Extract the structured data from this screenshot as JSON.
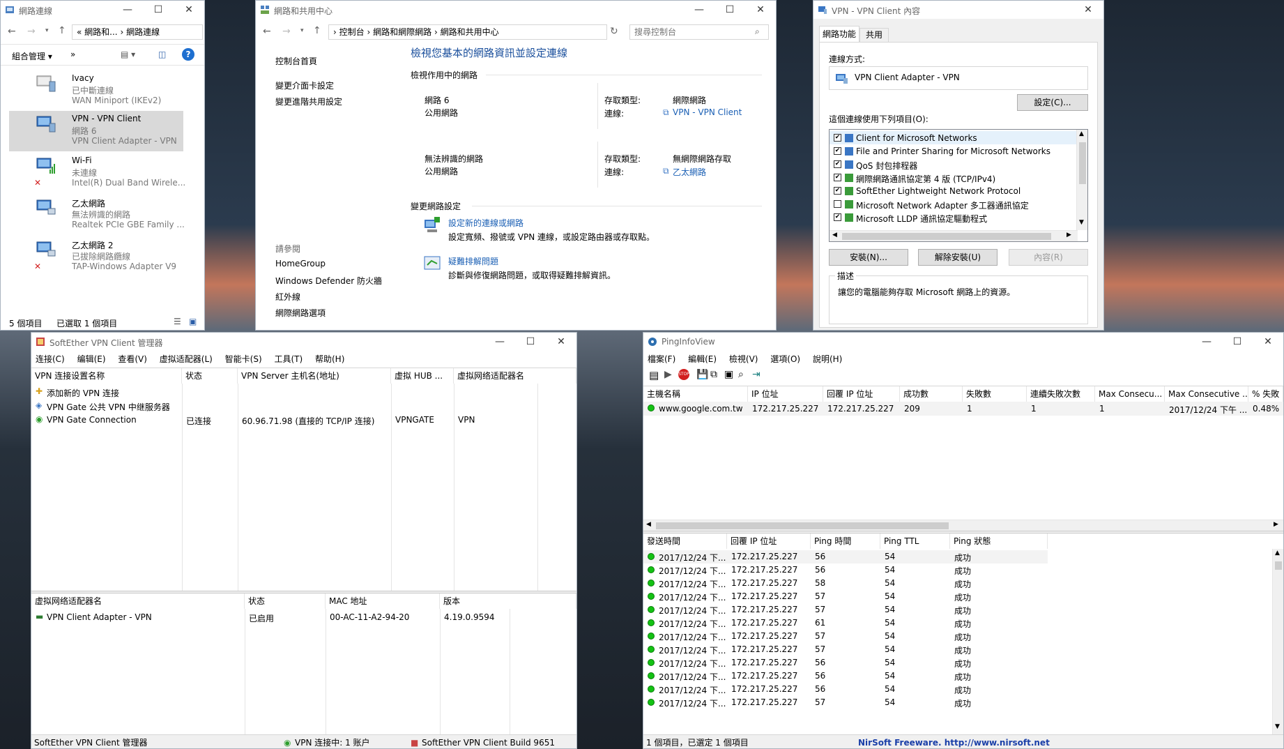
{
  "explorer": {
    "title": "網路連線",
    "address": [
      "«",
      "網路和...",
      "›",
      "網路連線"
    ],
    "toolbar_organize": "組合管理 ▾",
    "toolbar_more": "»",
    "items": [
      {
        "name": "Ivacy",
        "status": "已中斷連線",
        "device": "WAN Miniport (IKEv2)"
      },
      {
        "name": "VPN - VPN Client",
        "status": "網路  6",
        "device": "VPN Client Adapter - VPN"
      },
      {
        "name": "Wi-Fi",
        "status": "未連線",
        "device": "Intel(R) Dual Band Wirele..."
      },
      {
        "name": "乙太網路",
        "status": "無法辨識的網路",
        "device": "Realtek PCIe GBE Family ..."
      },
      {
        "name": "乙太網路 2",
        "status": "已拔除網路纜線",
        "device": "TAP-Windows Adapter V9"
      }
    ],
    "status_count": "5 個項目",
    "status_selected": "已選取 1 個項目"
  },
  "nsc": {
    "title": "網路和共用中心",
    "address": [
      "›",
      "控制台",
      "›",
      "網路和網際網路",
      "›",
      "網路和共用中心"
    ],
    "search_placeholder": "搜尋控制台",
    "side_links": [
      "控制台首頁",
      "變更介面卡設定",
      "變更進階共用設定"
    ],
    "see_also_label": "請參閱",
    "see_also": [
      "HomeGroup",
      "Windows Defender 防火牆",
      "紅外線",
      "網際網路選項"
    ],
    "heading": "檢視您基本的網路資訊並設定連線",
    "active_label": "檢視作用中的網路",
    "networks": [
      {
        "name": "網路  6",
        "type": "公用網路",
        "access_label": "存取類型:",
        "access": "網際網路",
        "conn_label": "連線:",
        "conn": "VPN - VPN Client"
      },
      {
        "name": "無法辨識的網路",
        "type": "公用網路",
        "access_label": "存取類型:",
        "access": "無網際網路存取",
        "conn_label": "連線:",
        "conn": "乙太網路"
      }
    ],
    "change_label": "變更網路設定",
    "tasks": [
      {
        "title": "設定新的連線或網路",
        "desc": "設定寬頻、撥號或 VPN 連線，或設定路由器或存取點。"
      },
      {
        "title": "疑難排解問題",
        "desc": "診斷與修復網路問題，或取得疑難排解資訊。"
      }
    ]
  },
  "props": {
    "title": "VPN - VPN Client 內容",
    "tabs": [
      "網路功能",
      "共用"
    ],
    "connect_using": "連線方式:",
    "adapter": "VPN Client Adapter - VPN",
    "configure": "設定(C)...",
    "items_label": "這個連線使用下列項目(O):",
    "items": [
      {
        "checked": true,
        "label": "Client for Microsoft Networks"
      },
      {
        "checked": true,
        "label": "File and Printer Sharing for Microsoft Networks"
      },
      {
        "checked": true,
        "label": "QoS 封包排程器"
      },
      {
        "checked": true,
        "label": "網際網路通訊協定第 4 版 (TCP/IPv4)"
      },
      {
        "checked": true,
        "label": "SoftEther Lightweight Network Protocol"
      },
      {
        "checked": false,
        "label": "Microsoft Network Adapter 多工器通訊協定"
      },
      {
        "checked": true,
        "label": "Microsoft LLDP 通訊協定驅動程式"
      }
    ],
    "install": "安裝(N)...",
    "uninstall": "解除安裝(U)",
    "properties": "內容(R)",
    "desc_label": "描述",
    "desc": "讓您的電腦能夠存取 Microsoft 網路上的資源。"
  },
  "softether": {
    "title": "SoftEther VPN Client 管理器",
    "menu": [
      "连接(C)",
      "编辑(E)",
      "查看(V)",
      "虚拟适配器(L)",
      "智能卡(S)",
      "工具(T)",
      "帮助(H)"
    ],
    "columns": [
      "VPN 连接设置名称",
      "状态",
      "VPN Server 主机名(地址)",
      "虚拟 HUB ...",
      "虚拟网络适配器名"
    ],
    "rows": [
      {
        "name": "添加新的 VPN 连接",
        "status": "",
        "server": "",
        "hub": "",
        "adapter": ""
      },
      {
        "name": "VPN Gate 公共 VPN 中继服务器",
        "status": "",
        "server": "",
        "hub": "",
        "adapter": ""
      },
      {
        "name": "VPN Gate Connection",
        "status": "已连接",
        "server": "60.96.71.98 (直接的 TCP/IP 连接)",
        "hub": "VPNGATE",
        "adapter": "VPN"
      }
    ],
    "adapter_columns": [
      "虚拟网络适配器名",
      "状态",
      "MAC 地址",
      "版本"
    ],
    "adapter_rows": [
      {
        "name": "VPN Client Adapter - VPN",
        "status": "已启用",
        "mac": "00-AC-11-A2-94-20",
        "version": "4.19.0.9594"
      }
    ],
    "status_left": "SoftEther VPN Client 管理器",
    "status_mid": "VPN 连接中: 1 账户",
    "status_right": "SoftEther VPN Client Build 9651"
  },
  "ping": {
    "title": "PingInfoView",
    "menu": [
      "檔案(F)",
      "編輯(E)",
      "檢視(V)",
      "選項(O)",
      "說明(H)"
    ],
    "columns": [
      "主機名稱",
      "IP 位址",
      "回覆 IP 位址",
      "成功數",
      "失敗數",
      "連續失敗次數",
      "Max Consecu...",
      "Max Consecutive ...",
      "% 失敗"
    ],
    "row": {
      "host": "www.google.com.tw",
      "ip": "172.217.25.227",
      "reply": "172.217.25.227",
      "success": "209",
      "fail": "1",
      "consec": "1",
      "max1": "1",
      "max2": "2017/12/24 下午 ...",
      "pct": "0.48%"
    },
    "log_columns": [
      "發送時間",
      "回覆 IP 位址",
      "Ping 時間",
      "Ping TTL",
      "Ping 狀態"
    ],
    "log": [
      {
        "time": "2017/12/24 下...",
        "ip": "172.217.25.227",
        "ms": "56",
        "ttl": "54",
        "st": "成功"
      },
      {
        "time": "2017/12/24 下...",
        "ip": "172.217.25.227",
        "ms": "56",
        "ttl": "54",
        "st": "成功"
      },
      {
        "time": "2017/12/24 下...",
        "ip": "172.217.25.227",
        "ms": "58",
        "ttl": "54",
        "st": "成功"
      },
      {
        "time": "2017/12/24 下...",
        "ip": "172.217.25.227",
        "ms": "57",
        "ttl": "54",
        "st": "成功"
      },
      {
        "time": "2017/12/24 下...",
        "ip": "172.217.25.227",
        "ms": "57",
        "ttl": "54",
        "st": "成功"
      },
      {
        "time": "2017/12/24 下...",
        "ip": "172.217.25.227",
        "ms": "61",
        "ttl": "54",
        "st": "成功"
      },
      {
        "time": "2017/12/24 下...",
        "ip": "172.217.25.227",
        "ms": "57",
        "ttl": "54",
        "st": "成功"
      },
      {
        "time": "2017/12/24 下...",
        "ip": "172.217.25.227",
        "ms": "57",
        "ttl": "54",
        "st": "成功"
      },
      {
        "time": "2017/12/24 下...",
        "ip": "172.217.25.227",
        "ms": "56",
        "ttl": "54",
        "st": "成功"
      },
      {
        "time": "2017/12/24 下...",
        "ip": "172.217.25.227",
        "ms": "56",
        "ttl": "54",
        "st": "成功"
      },
      {
        "time": "2017/12/24 下...",
        "ip": "172.217.25.227",
        "ms": "56",
        "ttl": "54",
        "st": "成功"
      },
      {
        "time": "2017/12/24 下...",
        "ip": "172.217.25.227",
        "ms": "57",
        "ttl": "54",
        "st": "成功"
      }
    ],
    "status_left": "1 個項目，已選定 1 個項目",
    "status_right": "NirSoft Freeware.  http://www.nirsoft.net"
  }
}
